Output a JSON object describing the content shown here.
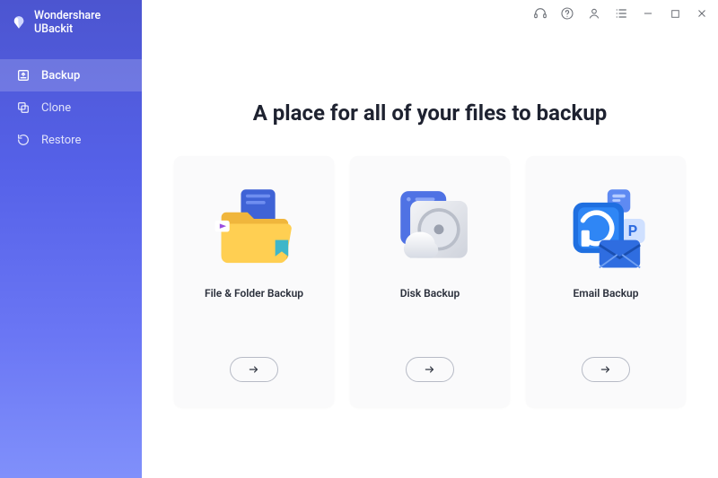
{
  "brand": {
    "name": "Wondershare UBackit"
  },
  "sidebar": {
    "items": [
      {
        "label": "Backup"
      },
      {
        "label": "Clone"
      },
      {
        "label": "Restore"
      }
    ]
  },
  "main": {
    "headline": "A place for all of your files to backup",
    "cards": [
      {
        "title": "File & Folder Backup"
      },
      {
        "title": "Disk Backup"
      },
      {
        "title": "Email Backup"
      }
    ]
  }
}
